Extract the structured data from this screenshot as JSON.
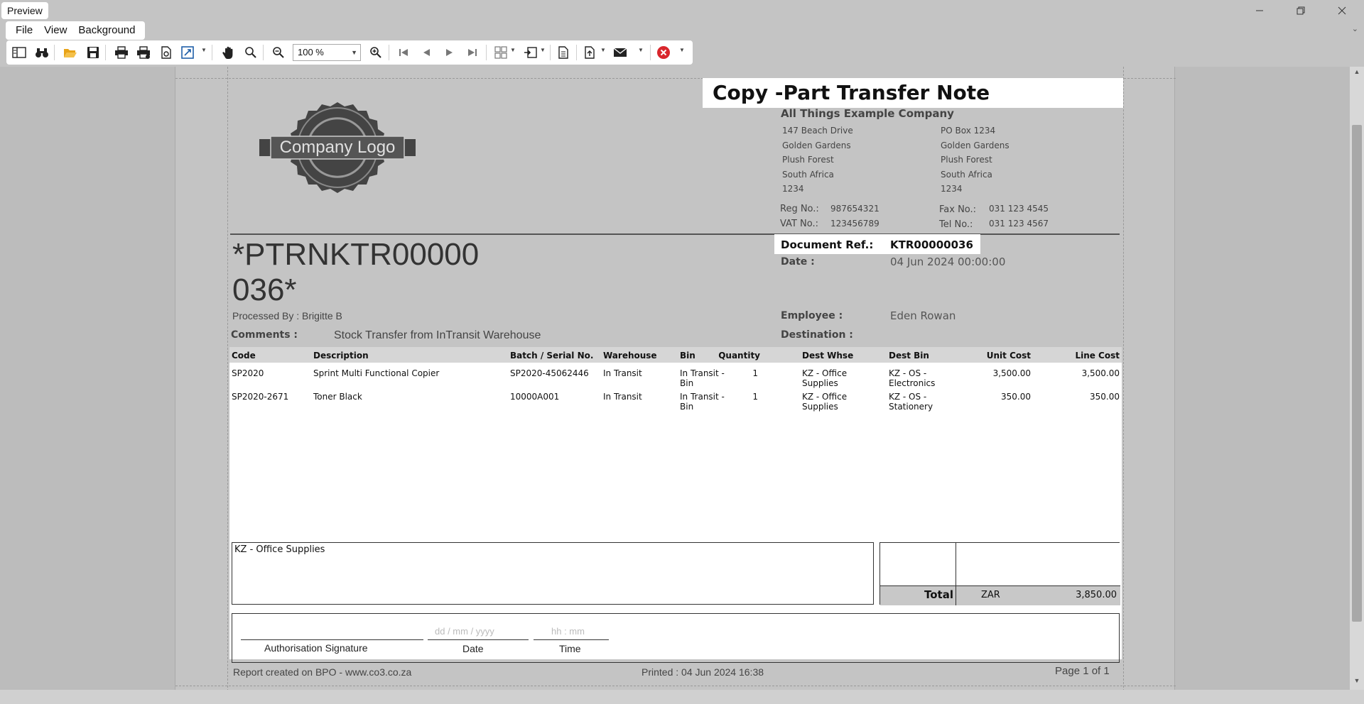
{
  "window": {
    "title": "Preview",
    "minimize": "─",
    "restore": "❐",
    "close": "✕"
  },
  "menu": {
    "items": [
      "File",
      "View",
      "Background"
    ]
  },
  "toolbar": {
    "zoom": "100 %"
  },
  "document": {
    "title": "Copy -Part Transfer Note",
    "logo_text": "Company Logo",
    "company": {
      "name": "All Things Example Company",
      "physical_address": [
        "147 Beach Drive",
        "Golden Gardens",
        "Plush Forest",
        "South Africa",
        "1234"
      ],
      "postal_address": [
        "PO Box 1234",
        "Golden Gardens",
        "Plush Forest",
        "South Africa",
        "1234"
      ],
      "reg_label": "Reg No.:",
      "reg_value": "987654321",
      "vat_label": "VAT No.:",
      "vat_value": "123456789",
      "fax_label": "Fax No.:",
      "fax_value": "031 123 4545",
      "tel_label": "Tel No.:",
      "tel_value": "031 123 4567"
    },
    "barcode_text": "*PTRNKTR00000036*",
    "processed_by": "Processed By : Brigitte B",
    "comments_label": "Comments :",
    "comments_value": "Stock Transfer from InTransit Warehouse",
    "doc_ref_label": "Document Ref.:",
    "doc_ref_value": "KTR00000036",
    "date_label": "Date :",
    "date_value": "04 Jun 2024 00:00:00",
    "employee_label": "Employee :",
    "employee_value": "Eden Rowan",
    "destination_label": "Destination :",
    "destination_value": "",
    "table": {
      "headers": {
        "code": "Code",
        "description": "Description",
        "batch": "Batch / Serial No.",
        "warehouse": "Warehouse",
        "bin": "Bin",
        "quantity": "Quantity",
        "dest_whse": "Dest Whse",
        "dest_bin": "Dest Bin",
        "unit_cost": "Unit Cost",
        "line_cost": "Line Cost"
      },
      "rows": [
        {
          "code": "SP2020",
          "description": "Sprint Multi Functional Copier",
          "batch": "SP2020-45062446",
          "warehouse": "In Transit",
          "bin": "In Transit -\nBin",
          "quantity": "1",
          "dest_whse": "KZ - Office\nSupplies",
          "dest_bin": "KZ - OS -\nElectronics",
          "unit_cost": "3,500.00",
          "line_cost": "3,500.00"
        },
        {
          "code": "SP2020-2671",
          "description": "Toner Black",
          "batch": "10000A001",
          "warehouse": "In Transit",
          "bin": "In Transit -\nBin",
          "quantity": "1",
          "dest_whse": "KZ - Office\nSupplies",
          "dest_bin": "KZ - OS -\nStationery",
          "unit_cost": "350.00",
          "line_cost": "350.00"
        }
      ]
    },
    "notes": "KZ - Office Supplies",
    "total_label": "Total",
    "currency": "ZAR",
    "total_value": "3,850.00",
    "signature": {
      "auth_caption": "Authorisation Signature",
      "date_placeholder": "dd / mm / yyyy",
      "date_caption": "Date",
      "time_placeholder": "hh : mm",
      "time_caption": "Time"
    },
    "footer": {
      "created": "Report created on BPO - www.co3.co.za",
      "printed": "Printed : 04 Jun 2024 16:38",
      "page": "Page 1 of 1"
    }
  }
}
